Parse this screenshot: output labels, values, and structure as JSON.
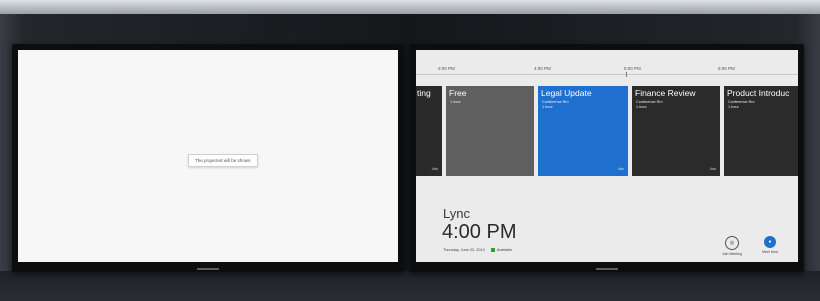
{
  "left_display": {
    "message": "The projected will be shown"
  },
  "right_display": {
    "timeline": {
      "ticks": [
        "3:00 PM",
        "4:00 PM",
        "5:00 PM",
        "6:00 PM"
      ]
    },
    "tiles": [
      {
        "title": "ting",
        "sub1": "",
        "sub2": "",
        "foot": "Join",
        "color": "#2a2a2a"
      },
      {
        "title": "Free",
        "sub1": "1 hour",
        "sub2": "",
        "foot": "",
        "color": "#5f5f5f"
      },
      {
        "title": "Legal Update",
        "sub1": "Conference Rm",
        "sub2": "1 hour",
        "foot": "Join",
        "color": "#1f6fcf"
      },
      {
        "title": "Finance Review",
        "sub1": "Conference Rm",
        "sub2": "1 hour",
        "foot": "Join",
        "color": "#2b2b2b"
      },
      {
        "title": "Product Introduc",
        "sub1": "Conference Rm",
        "sub2": "1 hour",
        "foot": "",
        "color": "#2b2b2b"
      }
    ],
    "app_name": "Lync",
    "current_time": "4:00 PM",
    "date": "Thursday, June 20, 2013",
    "status": "Available",
    "actions": [
      {
        "label": "Join Meeting",
        "icon": "meet-icon"
      },
      {
        "label": "Meet Now",
        "icon": "meet-now-icon"
      }
    ],
    "colors": {
      "accent": "#1f6fcf",
      "status_green": "#2e9e3e"
    }
  }
}
